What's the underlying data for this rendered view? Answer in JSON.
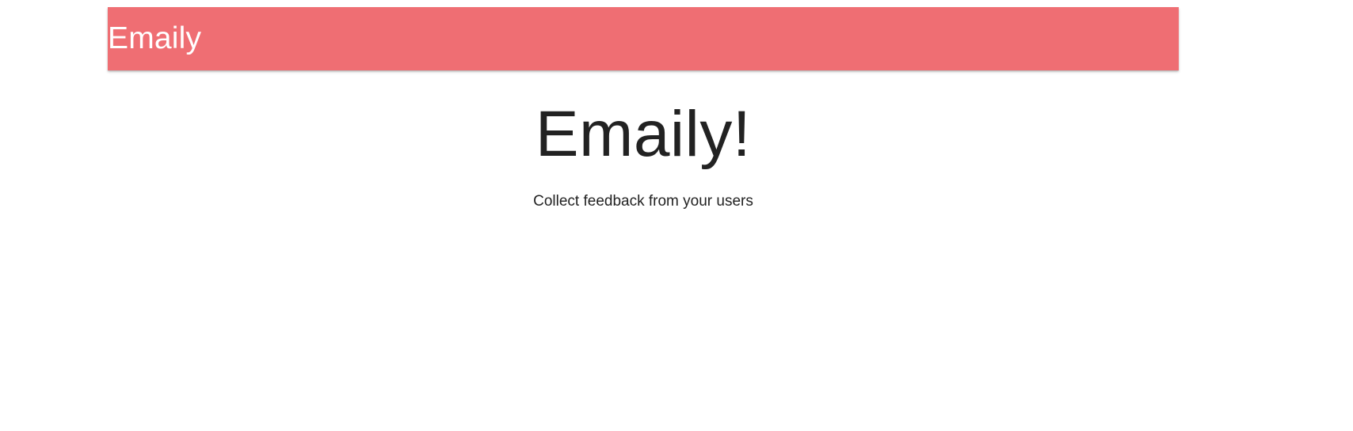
{
  "header": {
    "brand": "Emaily",
    "background_color": "#ef6e73"
  },
  "landing": {
    "title": "Emaily!",
    "subtitle": "Collect feedback from your users"
  }
}
